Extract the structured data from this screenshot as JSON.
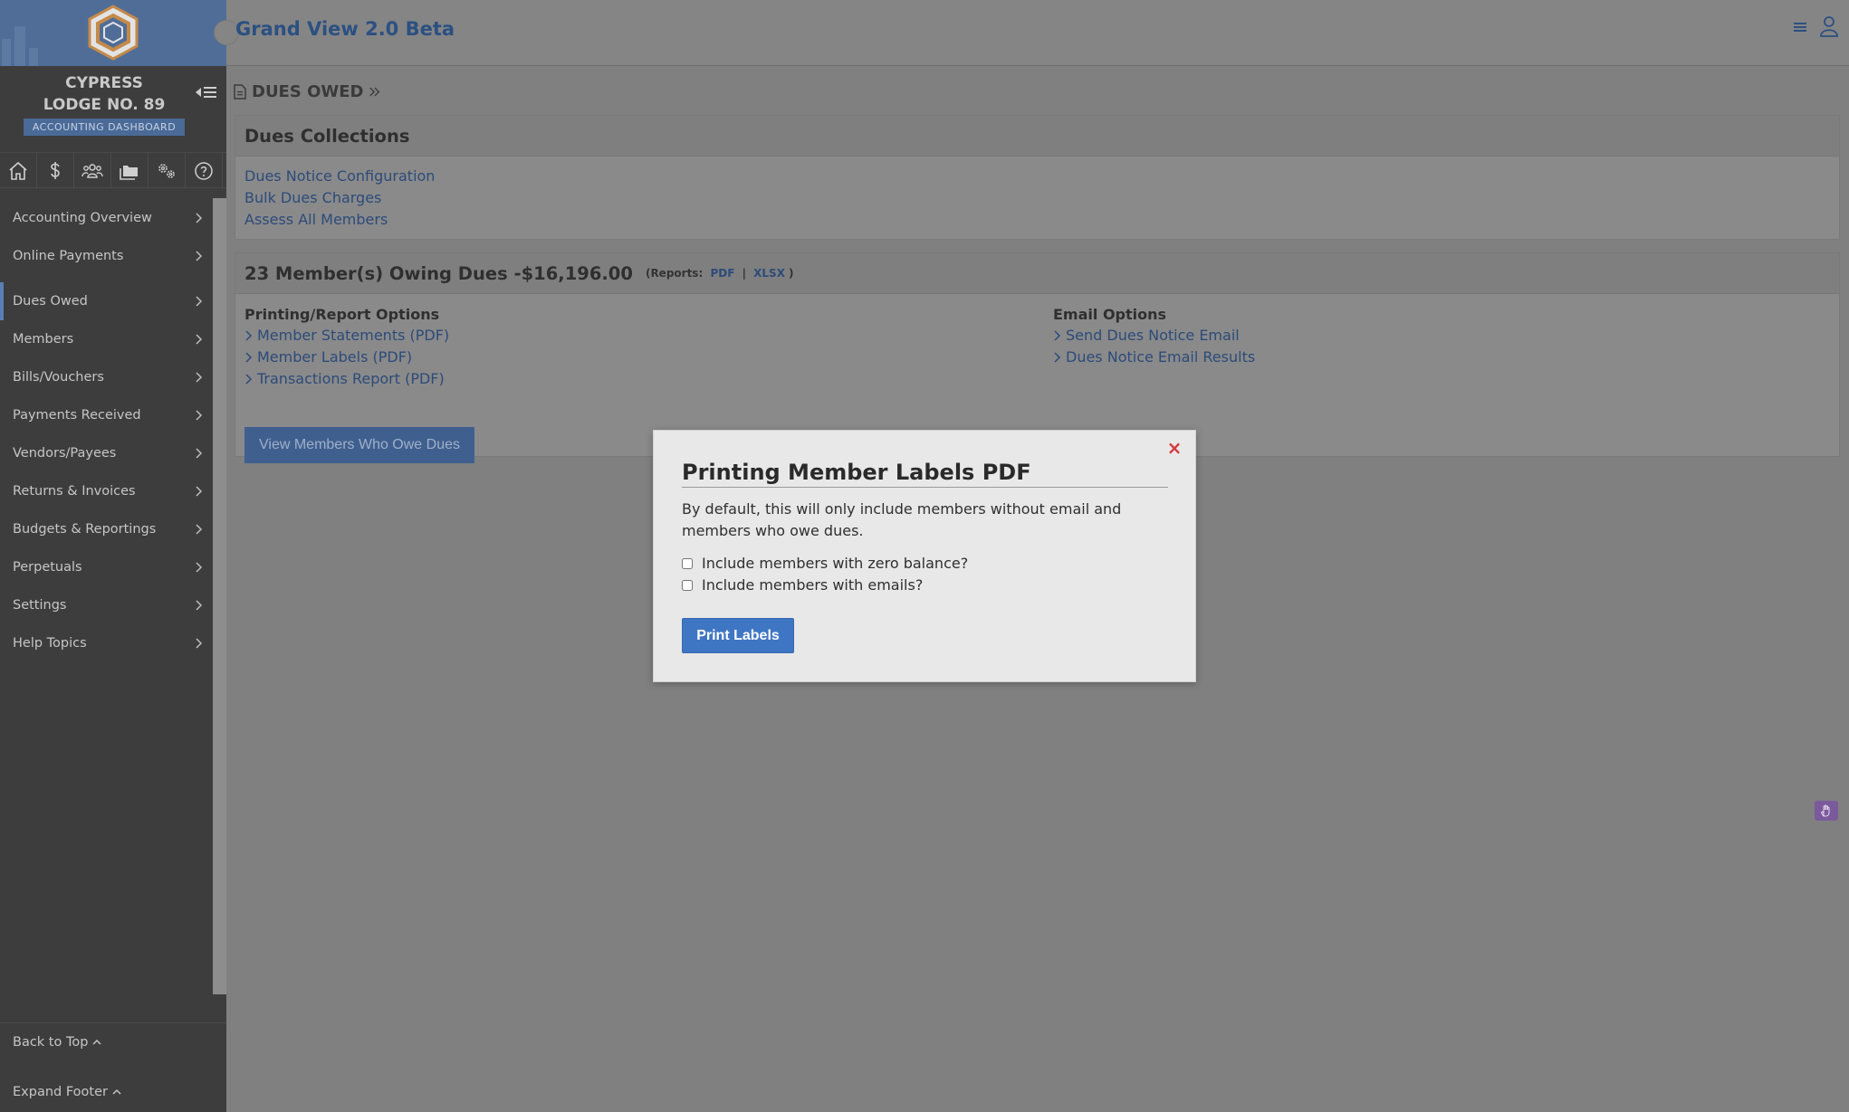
{
  "sidebar": {
    "lodge_line1": "CYPRESS",
    "lodge_line2": "LODGE NO. 89",
    "badge": "ACCOUNTING DASHBOARD",
    "icons": [
      "home-icon",
      "dollar-icon",
      "users-icon",
      "folders-icon",
      "gears-icon",
      "help-icon"
    ],
    "items": [
      {
        "label": "Accounting Overview"
      },
      {
        "label": "Online Payments"
      },
      {
        "label": "Dues Owed"
      },
      {
        "label": "Members"
      },
      {
        "label": "Bills/Vouchers"
      },
      {
        "label": "Payments Received"
      },
      {
        "label": "Vendors/Payees"
      },
      {
        "label": "Returns & Invoices"
      },
      {
        "label": "Budgets & Reportings"
      },
      {
        "label": "Perpetuals"
      },
      {
        "label": "Settings"
      },
      {
        "label": "Help Topics"
      }
    ],
    "footer": {
      "back_to_top": "Back to Top",
      "expand_footer": "Expand Footer"
    }
  },
  "header": {
    "title": "Grand View 2.0 Beta"
  },
  "breadcrumb": {
    "current": "DUES OWED"
  },
  "dues_collections": {
    "title": "Dues Collections",
    "links": [
      "Dues Notice Configuration",
      "Bulk Dues Charges",
      "Assess All Members"
    ]
  },
  "owing": {
    "title": "23 Member(s) Owing Dues -$16,196.00",
    "reports_prefix": "(Reports:",
    "report_pdf": "PDF",
    "report_sep": "|",
    "report_xlsx": "XLSX",
    "reports_suffix": ")",
    "printing_title": "Printing/Report Options",
    "printing_options": [
      "Member Statements (PDF)",
      "Member Labels (PDF)",
      "Transactions Report (PDF)"
    ],
    "email_title": "Email Options",
    "email_options": [
      "Send Dues Notice Email",
      "Dues Notice Email Results"
    ],
    "view_button": "View Members Who Owe Dues"
  },
  "modal": {
    "close": "×",
    "title": "Printing Member Labels PDF",
    "description": "By default, this will only include members without email and members who owe dues.",
    "checkbox_zero_balance": "Include members with zero balance?",
    "checkbox_emails": "Include members with emails?",
    "print_button": "Print Labels"
  },
  "colors": {
    "brand_blue": "#2b5082",
    "link_blue": "#2c4b7a",
    "primary_button": "#3f76c4",
    "close_red": "#d43a3a",
    "sidebar_bg": "#3d3d3d"
  }
}
